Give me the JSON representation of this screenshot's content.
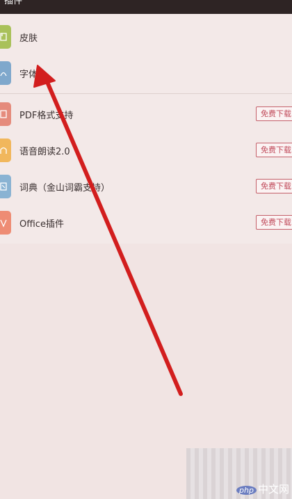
{
  "header": {
    "title": "插件"
  },
  "installed": [
    {
      "label": "皮肤",
      "icon": "skin-icon",
      "color": "#a9c15a"
    },
    {
      "label": "字体",
      "icon": "font-icon",
      "color": "#7fa8cc"
    }
  ],
  "plugins": [
    {
      "label": "PDF格式支持",
      "icon": "pdf-icon",
      "color": "#e58b7c",
      "button": "免费下载"
    },
    {
      "label": "语音朗读2.0",
      "icon": "speaker-icon",
      "color": "#f1b75c",
      "button": "免费下载"
    },
    {
      "label": "词典（金山词霸支持）",
      "icon": "dictionary-icon",
      "color": "#8ab3d3",
      "button": "免费下载"
    },
    {
      "label": "Office插件",
      "icon": "office-icon",
      "color": "#ee8c74",
      "button": "免费下载"
    }
  ],
  "watermark": {
    "php": "php",
    "text": "中文网"
  },
  "arrow_color": "#d21e1e"
}
